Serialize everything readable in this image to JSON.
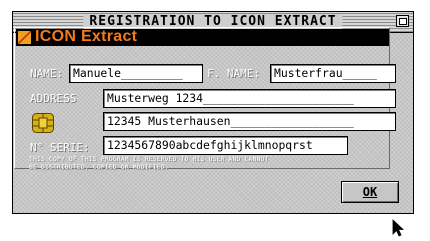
{
  "window": {
    "title": "REGISTRATION TO ICON EXTRACT"
  },
  "banner": {
    "app_name": "ICON Extract"
  },
  "form": {
    "name_label": "NAME:",
    "name_value": "Manuele_________",
    "fname_label": "F. NAME:",
    "fname_value": "Musterfrau_____",
    "address_label": "ADDRESS",
    "address_line1": "Musterweg 1234______________________",
    "address_line2": "12345 Musterhausen__________________",
    "serial_label": "N° SERIE:",
    "serial_value": "1234567890abcdefghijklmnopqrst"
  },
  "notice": {
    "line1": "THIS COPY OF THIS PROGRAM IS RESERVED TO HIS USER AND CANNOT",
    "line2": "BE DISTRIBUTED, COPIED OR MODIFIED."
  },
  "buttons": {
    "ok_label": "OK"
  },
  "icons": [
    "depth-gadget-icon",
    "logo-icon",
    "smartcard-chip-icon",
    "mouse-pointer-icon"
  ],
  "colors": {
    "window_bg": "#c6c6c6",
    "banner_bg": "#000000",
    "app_name": "#f47a1a",
    "label_text": "#ffffff",
    "field_bg": "#ffffff"
  }
}
